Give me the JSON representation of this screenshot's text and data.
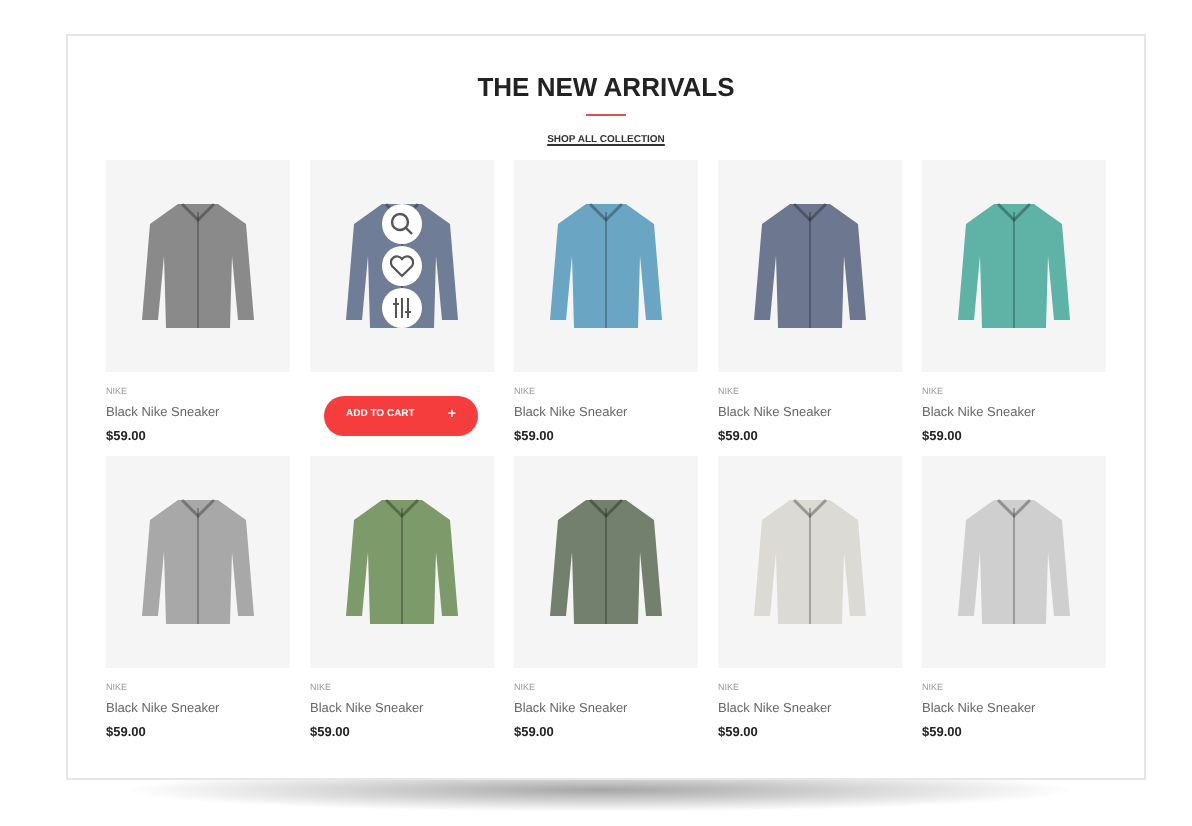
{
  "section": {
    "title": "THE NEW ARRIVALS",
    "link": "SHOP ALL COLLECTION"
  },
  "products": [
    {
      "brand": "NIKE",
      "name": "Black Nike Sneaker",
      "price": "$59.00",
      "color": "#8a8a8a",
      "hovered": false
    },
    {
      "color": "#6f7d96",
      "hovered": true,
      "add_to_cart": "ADD TO CART",
      "cart_symbol": "+"
    },
    {
      "brand": "NIKE",
      "name": "Black Nike Sneaker",
      "price": "$59.00",
      "color": "#6aa6c4",
      "hovered": false
    },
    {
      "brand": "NIKE",
      "name": "Black Nike Sneaker",
      "price": "$59.00",
      "color": "#6d7890",
      "hovered": false
    },
    {
      "brand": "NIKE",
      "name": "Black Nike Sneaker",
      "price": "$59.00",
      "color": "#5fb3a6",
      "hovered": false
    },
    {
      "brand": "NIKE",
      "name": "Black Nike Sneaker",
      "price": "$59.00",
      "color": "#a8a8a8",
      "hovered": false
    },
    {
      "brand": "NIKE",
      "name": "Black Nike Sneaker",
      "price": "$59.00",
      "color": "#7d9a6a",
      "hovered": false
    },
    {
      "brand": "NIKE",
      "name": "Black Nike Sneaker",
      "price": "$59.00",
      "color": "#72806d",
      "hovered": false
    },
    {
      "brand": "NIKE",
      "name": "Black Nike Sneaker",
      "price": "$59.00",
      "color": "#dcdad4",
      "hovered": false
    },
    {
      "brand": "NIKE",
      "name": "Black Nike Sneaker",
      "price": "$59.00",
      "color": "#cfcfcf",
      "hovered": false
    }
  ]
}
